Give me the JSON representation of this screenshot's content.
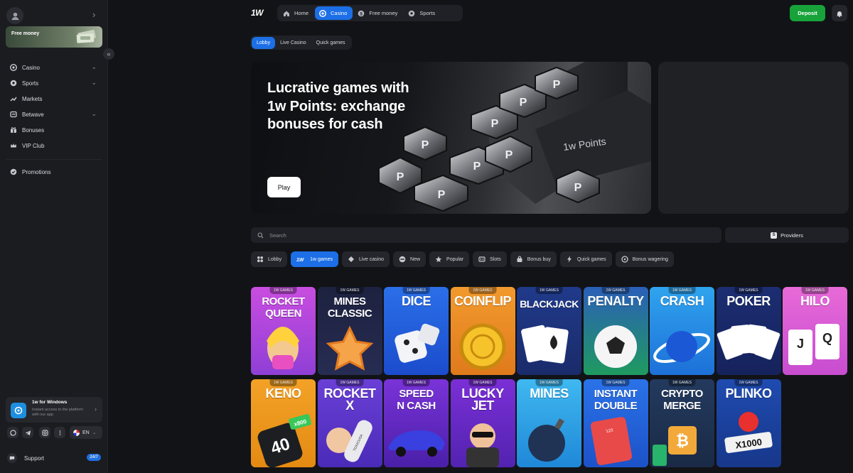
{
  "sidebar": {
    "free_money": "Free money",
    "nav": [
      {
        "label": "Casino",
        "icon": "casino-chip-icon",
        "chevron": true
      },
      {
        "label": "Sports",
        "icon": "ball-icon",
        "chevron": true
      },
      {
        "label": "Markets",
        "icon": "chart-icon",
        "chevron": false
      },
      {
        "label": "Betwave",
        "icon": "betwave-icon",
        "chevron": true
      },
      {
        "label": "Bonuses",
        "icon": "gift-icon",
        "chevron": false
      },
      {
        "label": "VIP Club",
        "icon": "crown-icon",
        "chevron": false
      },
      {
        "label": "Promotions",
        "icon": "promo-icon",
        "chevron": false
      }
    ],
    "app_promo": {
      "title": "1w for Windows",
      "subtitle": "Instant access to the platform with our app"
    },
    "language": "EN",
    "support": {
      "label": "Support",
      "badge": "24/7"
    }
  },
  "header": {
    "logo": "1W",
    "tabs": [
      {
        "label": "Home",
        "icon": "home-icon",
        "active": false
      },
      {
        "label": "Casino",
        "icon": "casino-chip-icon",
        "active": true
      },
      {
        "label": "Free money",
        "icon": "coin-icon",
        "active": false
      },
      {
        "label": "Sports",
        "icon": "ball-icon",
        "active": false
      }
    ],
    "deposit": "Deposit"
  },
  "subtabs": [
    {
      "label": "Lobby",
      "active": true
    },
    {
      "label": "Live Casino",
      "active": false
    },
    {
      "label": "Quick games",
      "active": false
    }
  ],
  "hero": {
    "title": "Lucrative games with 1w Points: exchange bonuses for cash",
    "button": "Play",
    "coin_letter": "P",
    "card_text": "1w Points"
  },
  "search": {
    "placeholder": "Search",
    "providers": "Providers"
  },
  "chips": [
    {
      "label": "Lobby",
      "icon": "grid-icon",
      "active": false
    },
    {
      "label": "1w games",
      "icon": "1w-icon",
      "active": true
    },
    {
      "label": "Live casino",
      "icon": "live-icon",
      "active": false
    },
    {
      "label": "New",
      "icon": "new-icon",
      "active": false
    },
    {
      "label": "Popular",
      "icon": "star-icon",
      "active": false
    },
    {
      "label": "Slots",
      "icon": "slot-icon",
      "active": false
    },
    {
      "label": "Bonus buy",
      "icon": "bag-icon",
      "active": false
    },
    {
      "label": "Quick games",
      "icon": "lightning-icon",
      "active": false
    },
    {
      "label": "Bonus wagering",
      "icon": "bonus-icon",
      "active": false
    }
  ],
  "games_tag": "1W GAMES",
  "games": [
    {
      "title": "ROCKET\nQUEEN",
      "bg": [
        "#c94de0",
        "#8f3fd6"
      ],
      "art": "queen"
    },
    {
      "title": "MINES\nCLASSIC",
      "bg": [
        "#1d2240",
        "#272c52"
      ],
      "art": "star"
    },
    {
      "title": "DICE",
      "bg": [
        "#2b6fe8",
        "#1b4ccc"
      ],
      "art": "dice"
    },
    {
      "title": "COINFLIP",
      "bg": [
        "#f29a2e",
        "#e07a1c"
      ],
      "art": "coin"
    },
    {
      "title": "BLACKJACK",
      "bg": [
        "#203a8a",
        "#1a2b6a"
      ],
      "art": "cards"
    },
    {
      "title": "PENALTY",
      "bg": [
        "#2b5fb8",
        "#1f9a60"
      ],
      "art": "ball"
    },
    {
      "title": "CRASH",
      "bg": [
        "#2fa4ee",
        "#1d70d8"
      ],
      "art": "planet"
    },
    {
      "title": "POKER",
      "bg": [
        "#1c2d72",
        "#15225c"
      ],
      "art": "fan"
    },
    {
      "title": "HILO",
      "bg": [
        "#e86ad8",
        "#c74dd0"
      ],
      "art": "hilo"
    },
    {
      "title": "KENO",
      "bg": [
        "#f3a227",
        "#e48a12"
      ],
      "art": "keno"
    },
    {
      "title": "ROCKET\nX",
      "bg": [
        "#6a3fd6",
        "#4a2bb8"
      ],
      "art": "rocket"
    },
    {
      "title": "SPEED\nN CASH",
      "bg": [
        "#7a33d8",
        "#4a1fa8"
      ],
      "art": "car"
    },
    {
      "title": "LUCKY\nJET",
      "bg": [
        "#7b2fd6",
        "#5223b0"
      ],
      "art": "jet"
    },
    {
      "title": "MINES",
      "bg": [
        "#3fb8f0",
        "#1f88d8"
      ],
      "art": "bomb"
    },
    {
      "title": "INSTANT\nDOUBLE",
      "bg": [
        "#2b72e8",
        "#1c52c8"
      ],
      "art": "double"
    },
    {
      "title": "CRYPTO\nMERGE",
      "bg": [
        "#233a5e",
        "#1a2a46"
      ],
      "art": "crypto"
    },
    {
      "title": "PLINKO",
      "bg": [
        "#1f4bb0",
        "#17378a"
      ],
      "art": "plinko"
    }
  ],
  "art_text": {
    "keno_num": "40",
    "keno_mult": "x800",
    "rocket_label": "TOXICUSA",
    "plinko_mult": "X1000",
    "instant_num": "123",
    "card_j": "J",
    "card_q": "Q"
  },
  "colors": {
    "accent": "#1c6fe6",
    "deposit": "#17a33a",
    "background": "#121316",
    "sidebar": "#1b1c20"
  }
}
